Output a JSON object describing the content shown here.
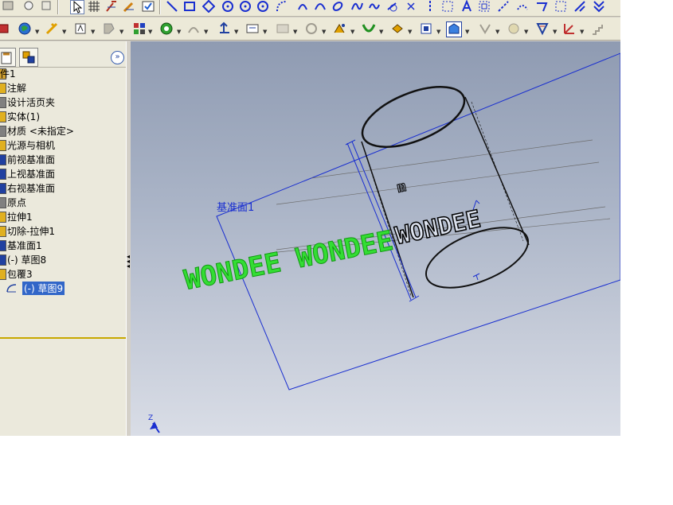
{
  "toolbar_top": {
    "tools": [
      "select-icon",
      "grid-icon",
      "smart-dimension-icon",
      "sketch-icon",
      "check-icon",
      "line-icon",
      "rectangle-icon",
      "polygon-icon",
      "circle-icon",
      "perimeter-circle-icon",
      "arc-icon",
      "tangent-arc-icon",
      "spline-icon",
      "ellipse-icon",
      "centerline-icon",
      "point-icon",
      "text-icon",
      "mirror-icon",
      "offset-icon",
      "trim-icon",
      "extend-icon",
      "convert-entities-icon"
    ]
  },
  "toolbar_second": {
    "tools": [
      "view-orientation-icon",
      "appearance-icon",
      "section-view-icon",
      "display-style-icon",
      "hide-show-icon",
      "edit-appearance-icon",
      "apply-scene-icon",
      "lights-icon",
      "rotate-icon",
      "zoom-icon",
      "view-setting-icon",
      "3d-sketch-icon",
      "datum-icon",
      "reference-geometry-icon",
      "curves-icon",
      "dimxpert-icon",
      "annotation-icon",
      "mark-icon",
      "weld-icon",
      "relations-icon",
      "dimensions-icon"
    ]
  },
  "panel": {
    "expand_label": "»",
    "tree": [
      {
        "label": "件1",
        "icon": "part-icon"
      },
      {
        "label": "注解",
        "icon": "annotation-folder-icon"
      },
      {
        "label": "设计活页夹",
        "icon": "design-binder-icon"
      },
      {
        "label": "实体(1)",
        "icon": "solid-bodies-icon"
      },
      {
        "label": "材质 <未指定>",
        "icon": "material-icon"
      },
      {
        "label": "光源与相机",
        "icon": "lights-cameras-icon"
      },
      {
        "label": "前视基准面",
        "icon": "plane-icon"
      },
      {
        "label": "上视基准面",
        "icon": "plane-icon"
      },
      {
        "label": "右视基准面",
        "icon": "plane-icon"
      },
      {
        "label": "原点",
        "icon": "origin-icon"
      },
      {
        "label": "拉伸1",
        "icon": "extrude-icon"
      },
      {
        "label": "切除-拉伸1",
        "icon": "cut-extrude-icon"
      },
      {
        "label": "基准面1",
        "icon": "plane-icon"
      },
      {
        "label": "(-) 草图8",
        "icon": "sketch-icon"
      },
      {
        "label": "包覆3",
        "icon": "wrap-icon"
      },
      {
        "label": "(-) 草图9",
        "icon": "sketch-icon",
        "selected": true
      }
    ]
  },
  "viewport": {
    "plane_label": "基准面1",
    "sketch_text": "WONDEE WONDEE",
    "wrapped_text": "WONDEE",
    "axis_label": "Z",
    "colors": {
      "plane": "#1a2fd0",
      "sketch_text": "#22cc22",
      "model": "#111111"
    }
  }
}
